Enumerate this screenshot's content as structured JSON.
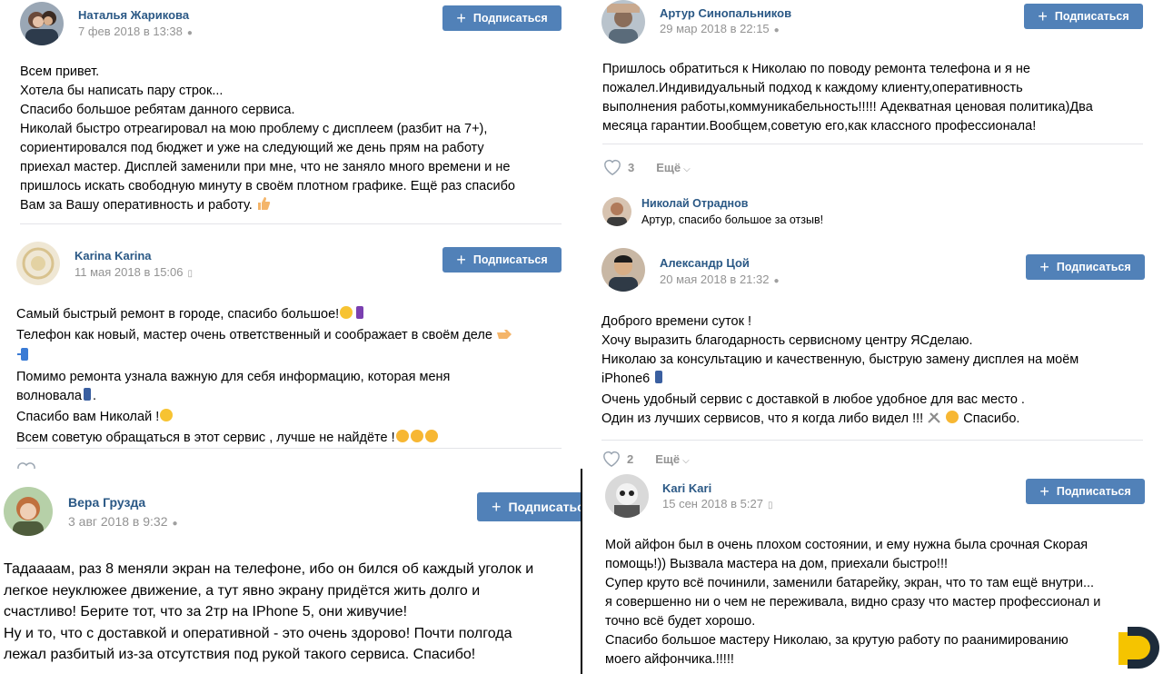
{
  "subscribe_label": "Подписаться",
  "colors": {
    "link": "#2a5885",
    "button": "#5181b8",
    "muted": "#939393",
    "divider": "#e3e4e8",
    "logo_yellow": "#f5c400",
    "logo_dark": "#1d2b3a"
  },
  "posts": [
    {
      "author": "Наталья Жарикова",
      "date": "7 фев 2018 в 13:38",
      "device_icon": "apple-icon",
      "lines": [
        "Всем привет.",
        "Хотела бы написать пару строк...",
        "Спасибо большое ребятам данного сервиса.",
        "Николай быстро отреагировал на мою проблему с дисплеем (разбит на 7+),",
        "сориентировался под бюджет и уже на следующий же день прям на работу",
        "приехал мастер. Дисплей заменили при мне, что не заняло много времени и не",
        "пришлось искать свободную минуту в своём плотном графике. Ещё раз спасибо",
        "Вам за Вашу оперативность и работу."
      ]
    },
    {
      "author": "Артур Синопальников",
      "date": "29 мар 2018 в 22:15",
      "device_icon": "apple-icon",
      "lines": [
        "Пришлось обратиться к Николаю по поводу ремонта телефона и я не",
        "пожалел.Индивидуальный подход к каждому клиенту,оперативность",
        "выполнения работы,коммуникабельность!!!!! Адекватная ценовая политика)Два",
        "месяца гарантии.Вообщем,советую его,как классного профессионала!"
      ],
      "likes": "3",
      "more_label": "Ещё",
      "reply": {
        "author": "Николай Отраднов",
        "text": "Артур, спасибо большое за отзыв!"
      }
    },
    {
      "author": "Karina Karina",
      "date": "11 мая 2018 в 15:06",
      "device_icon": "phone-icon",
      "lines": [
        "Самый быстрый ремонт в городе, спасибо большое!",
        "Телефон как новый, мастер очень ответственный и соображает в своём деле",
        "",
        "Помимо ремонта узнала важную для себя информацию, которая меня",
        "волновала",
        "Спасибо вам Николай !",
        "Всем советую обращаться в этот сервис , лучше не найдёте !"
      ]
    },
    {
      "author": "Александр Цой",
      "date": "20 мая 2018 в 21:32",
      "device_icon": "apple-icon",
      "lines": [
        "Доброго времени суток !",
        "Хочу выразить благодарность сервисному центру ЯСделаю.",
        "Николаю за консультацию и качественную, быструю замену дисплея на моём",
        "iPhone6",
        "Очень удобный сервис с доставкой в любое удобное для вас место .",
        "Один из лучших сервисов, что я когда либо видел !!!",
        "Спасибо."
      ],
      "likes": "2",
      "more_label": "Ещё"
    },
    {
      "author": "Вера Грузда",
      "date": "3 авг 2018 в 9:32",
      "device_icon": "apple-icon",
      "lines": [
        "Тадаааам, раз 8 меняли экран на телефоне, ибо он бился об каждый уголок и",
        "легкое неуклюжее движение, а тут явно экрану придётся жить долго и",
        "счастливо! Берите тот, что за 2тр на IPhone 5, они живучие!",
        "Ну и то, что с доставкой и оперативной - это очень здорово! Почти полгода",
        "лежал разбитый из-за отсутствия под рукой такого сервиса. Спасибо!"
      ]
    },
    {
      "author": "Kari Kari",
      "date": "15 сен 2018 в 5:27",
      "device_icon": "phone-icon",
      "lines": [
        "Мой айфон был в очень плохом состоянии, и ему нужна была срочная Скорая",
        "помощь!)) Вызвала мастера на дом, приехали быстро!!!",
        "Супер круто всё починили, заменили батарейку, экран, что то там ещё внутри...",
        "я совершенно ни о чем не переживала, видно сразу что мастер профессионал и",
        "точно всё будет хорошо.",
        "Спасибо большое мастеру Николаю, за крутую работу по раанимированию",
        "моего айфончика.!!!!!"
      ]
    }
  ]
}
